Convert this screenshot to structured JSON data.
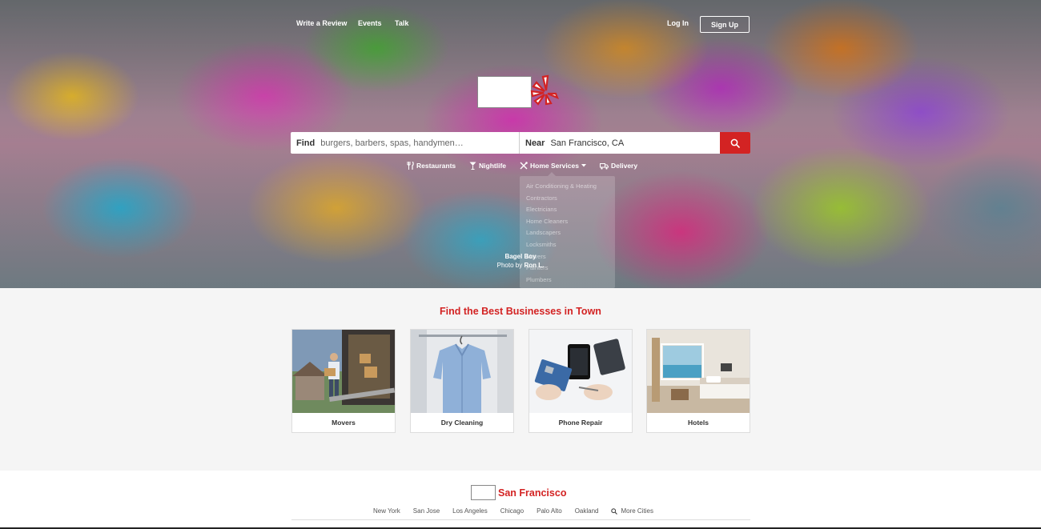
{
  "header": {
    "nav_left": [
      "Write a Review",
      "Events",
      "Talk"
    ],
    "login_label": "Log In",
    "signup_label": "Sign Up"
  },
  "search": {
    "find_label": "Find",
    "find_placeholder": "burgers, barbers, spas, handymen…",
    "near_label": "Near",
    "near_value": "San Francisco, CA",
    "button_icon": "search-icon"
  },
  "categories": [
    {
      "label": "Restaurants",
      "icon": "utensils-icon"
    },
    {
      "label": "Nightlife",
      "icon": "cocktail-icon"
    },
    {
      "label": "Home Services",
      "icon": "tools-icon"
    },
    {
      "label": "Delivery",
      "icon": "delivery-truck-icon"
    }
  ],
  "home_services_menu": [
    "Air Conditioning & Heating",
    "Contractors",
    "Electricians",
    "Home Cleaners",
    "Landscapers",
    "Locksmiths",
    "Movers",
    "Painters",
    "Plumbers"
  ],
  "photo_credit": {
    "business": "Bagel Boy",
    "prefix": "Photo by",
    "author": "Ron L."
  },
  "best": {
    "title": "Find the Best Businesses in Town",
    "cards": [
      {
        "label": "Movers"
      },
      {
        "label": "Dry Cleaning"
      },
      {
        "label": "Phone Repair"
      },
      {
        "label": "Hotels"
      }
    ]
  },
  "city": {
    "name": "San Francisco",
    "links": [
      "New York",
      "San Jose",
      "Los Angeles",
      "Chicago",
      "Palo Alto",
      "Oakland"
    ],
    "more_label": "More Cities"
  },
  "colors": {
    "brand_red": "#d32323",
    "footer_bg": "#f5f5f5"
  }
}
